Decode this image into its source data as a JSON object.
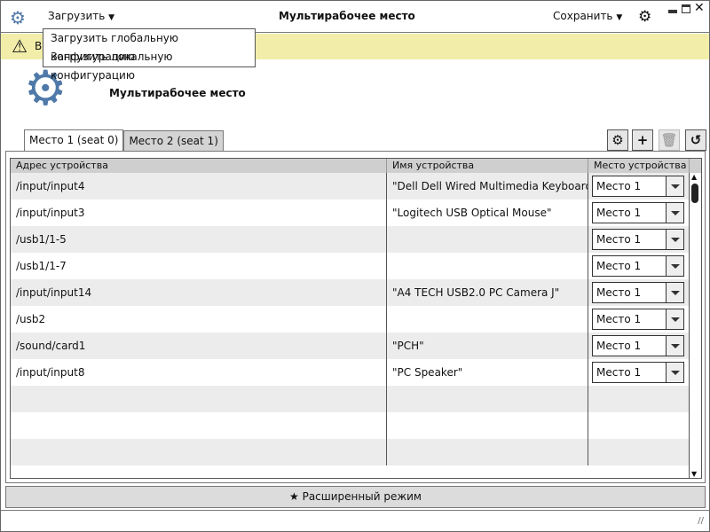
{
  "titlebar": {
    "load_label": "Загрузить",
    "title": "Мультирабочее место",
    "save_label": "Сохранить"
  },
  "load_menu": {
    "items": [
      "Загрузить глобальную конфигурацию",
      "Загрузить локальную конфигурацию"
    ]
  },
  "warning": {
    "text": "В"
  },
  "header": {
    "title": "Мультирабочее место"
  },
  "tabs": [
    {
      "label": "Место 1 (seat 0)",
      "active": true
    },
    {
      "label": "Место 2 (seat 1)",
      "active": false
    }
  ],
  "table": {
    "columns": [
      "Адрес устройства",
      "Имя устройства",
      "Место устройства"
    ],
    "rows": [
      {
        "address": "/input/input4",
        "name": "\"Dell Dell Wired Multimedia Keyboard\"",
        "seat": "Место 1"
      },
      {
        "address": "/input/input3",
        "name": "\"Logitech USB Optical Mouse\"",
        "seat": "Место 1"
      },
      {
        "address": "/usb1/1-5",
        "name": "",
        "seat": "Место 1"
      },
      {
        "address": "/usb1/1-7",
        "name": "",
        "seat": "Место 1"
      },
      {
        "address": "/input/input14",
        "name": "\"A4 TECH USB2.0 PC Camera J\"",
        "seat": "Место 1"
      },
      {
        "address": "/usb2",
        "name": "",
        "seat": "Место 1"
      },
      {
        "address": "/sound/card1",
        "name": "\"PCH\"",
        "seat": "Место 1"
      },
      {
        "address": "/input/input8",
        "name": "\"PC Speaker\"",
        "seat": "Место 1"
      }
    ]
  },
  "advanced_button": {
    "label": "Расширенный режим"
  },
  "colors": {
    "accent": "#4f79a8",
    "warning_bg": "#f2eeaa"
  }
}
